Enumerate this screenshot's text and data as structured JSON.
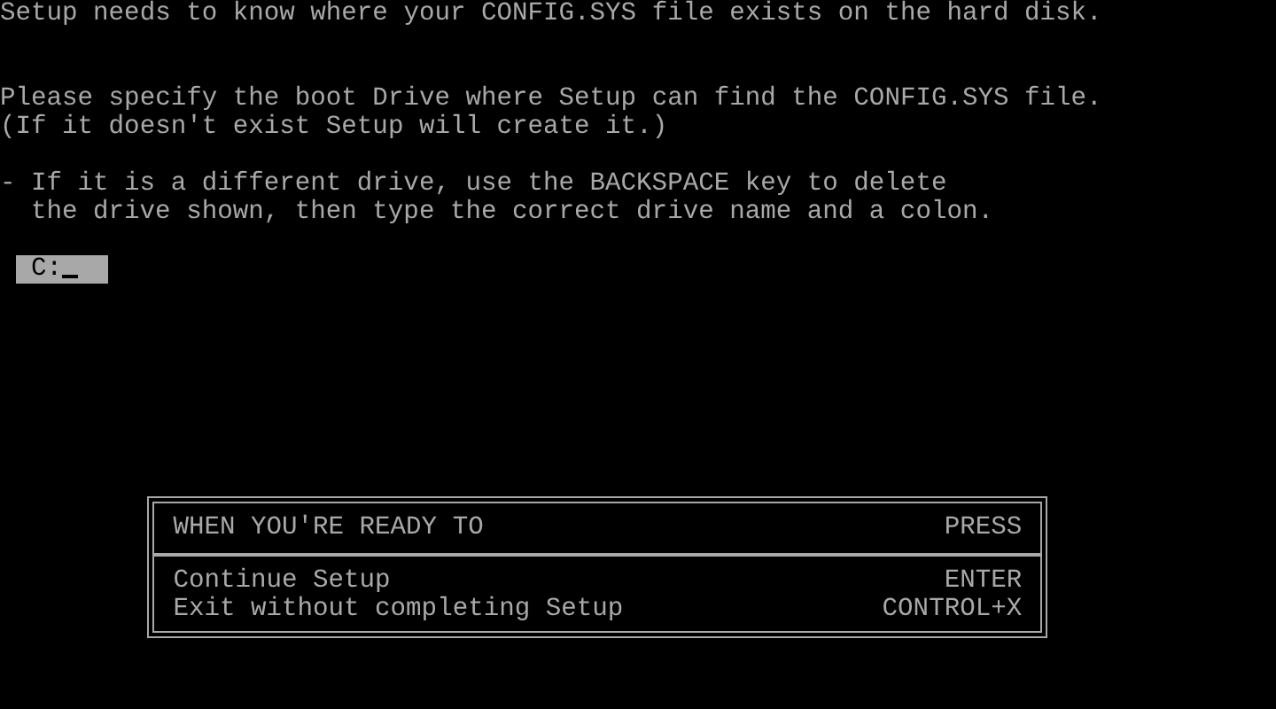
{
  "intro": "Setup needs to know where your CONFIG.SYS file exists on the hard disk.",
  "instructions": [
    "Please specify the boot Drive where Setup can find the CONFIG.SYS file.",
    "(If it doesn't exist Setup will create it.)"
  ],
  "hint": {
    "marker": "-",
    "lines": [
      "If it is a different drive, use the BACKSPACE key to delete",
      "the drive shown, then type the correct drive name and a colon."
    ]
  },
  "drive_field": {
    "value": "C:"
  },
  "key_box": {
    "header": {
      "action": "WHEN YOU'RE READY TO",
      "key": "PRESS"
    },
    "rows": [
      {
        "action": "Continue Setup",
        "key": "ENTER"
      },
      {
        "action": "Exit without completing Setup",
        "key": "CONTROL+X"
      }
    ]
  }
}
